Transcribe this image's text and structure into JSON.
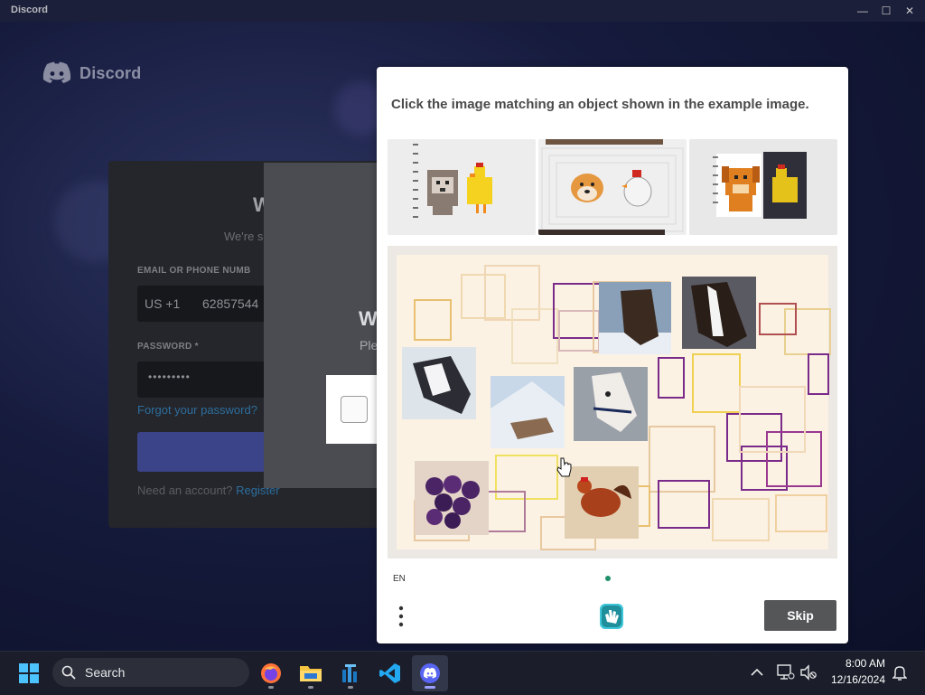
{
  "window": {
    "title": "Discord"
  },
  "brand": {
    "name": "Discord"
  },
  "login": {
    "heading": "W",
    "subtext": "We're s",
    "email_label": "EMAIL OR PHONE NUMB",
    "country_code": "US +1",
    "phone_value": "62857544",
    "password_label": "PASSWORD *",
    "password_value": "•••••••••",
    "forgot_link": "Forgot your password?",
    "need_account": "Need an account?",
    "register_link": "Register"
  },
  "verify_modal": {
    "title": "W",
    "subtitle": "Ple"
  },
  "captcha": {
    "prompt": "Click the image matching an object shown in the example image.",
    "language": "EN",
    "skip_label": "Skip"
  },
  "taskbar": {
    "search_placeholder": "Search",
    "time": "8:00 AM",
    "date": "12/16/2024",
    "apps": [
      "firefox",
      "file-explorer",
      "azure-data-studio",
      "vscode",
      "discord"
    ]
  },
  "colors": {
    "discord_blurple": "#5865f2",
    "skip_button": "#555658",
    "hcaptcha_teal": "#1f8f6c"
  }
}
